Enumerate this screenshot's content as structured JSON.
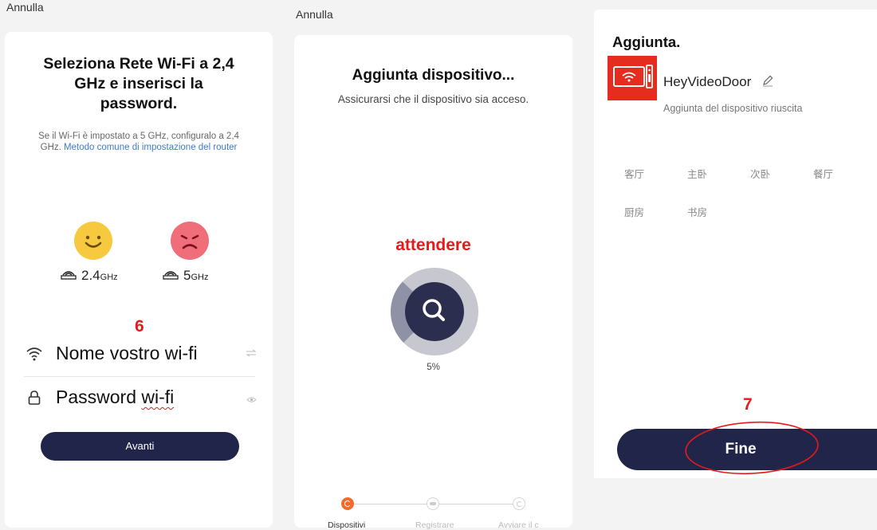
{
  "screen1": {
    "cancel": "Annulla",
    "title": "Seleziona Rete Wi-Fi a 2,4 GHz e inserisci la password.",
    "info_text": "Se il Wi-Fi è impostato a 5 GHz, configuralo a 2,4 GHz.",
    "info_link": "Metodo comune di impostazione del router",
    "freq_ok": {
      "value": "2.4",
      "unit": "GHz",
      "face": "happy-face-icon",
      "color": "#f7c93e"
    },
    "freq_bad": {
      "value": "5",
      "unit": "GHz",
      "face": "sad-face-icon",
      "color": "#f06d7a"
    },
    "annotation_number": "6",
    "wifi_field": "Nome vostro wi-fi",
    "password_field": {
      "prefix": "Password ",
      "underlined": "wi-fi"
    },
    "next_button": "Avanti"
  },
  "screen2": {
    "cancel": "Annulla",
    "title": "Aggiunta dispositivo...",
    "subtitle": "Assicurarsi che il dispositivo sia acceso.",
    "annotation_wait": "attendere",
    "progress_percent": 5,
    "progress_label": "5%",
    "steps": [
      {
        "label": "Dispositivi",
        "state": "active"
      },
      {
        "label": "Registrare",
        "state": "pending"
      },
      {
        "label": "Avviare il c",
        "state": "pending"
      }
    ]
  },
  "screen3": {
    "title": "Aggiunta.",
    "device_name": "HeyVideoDoor",
    "device_status": "Aggiunta del dispositivo riuscita",
    "rooms_row1": [
      "客厅",
      "主卧",
      "次卧",
      "餐厅"
    ],
    "rooms_row2": [
      "厨房",
      "书房"
    ],
    "annotation_number": "7",
    "done_button": "Fine"
  },
  "colors": {
    "accent_dark": "#22254a",
    "annotation_red": "#e51b1b",
    "progress_orange": "#f26a2c",
    "device_red": "#e52c1f",
    "link_blue": "#3f7cc6"
  }
}
